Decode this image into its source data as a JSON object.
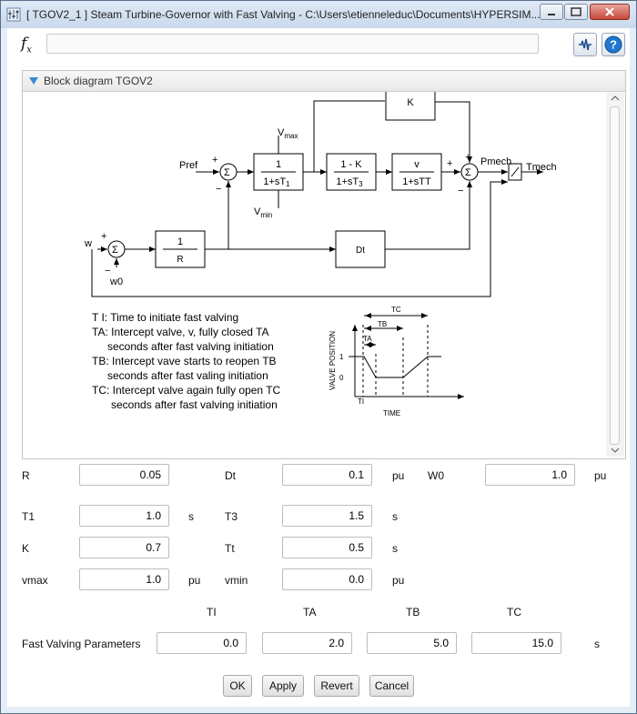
{
  "window": {
    "title": "[ TGOV2_1 ]  Steam Turbine-Governor with Fast Valving - C:\\Users\\etienneleduc\\Documents\\HYPERSIM..."
  },
  "toolbar": {
    "fx_label": "fx",
    "formula_value": ""
  },
  "panel": {
    "title": "Block diagram TGOV2",
    "diagram": {
      "pref": "Pref",
      "plus": "+",
      "minus": "−",
      "sigma": "Σ",
      "vmax": "V",
      "vmax_sub": "max",
      "vmin": "V",
      "vmin_sub": "min",
      "block_t1_num": "1",
      "block_t1_den": "1+sT",
      "block_t1_sub": "1",
      "block_t3_num": "1 - K",
      "block_t3_den": "1+sT",
      "block_t3_sub": "3",
      "block_tt_num": "v",
      "block_tt_den": "1+sTT",
      "block_k": "K",
      "block_r_num": "1",
      "block_r_den": "R",
      "block_dt": "Dt",
      "pmech": "Pmech",
      "tmech": "Tmech",
      "w": "w",
      "w0": "w0",
      "notes": [
        "T I: Time to initiate fast valving",
        "TA: Intercept valve, v, fully closed TA",
        "seconds after fast valving initiation",
        "TB: Intercept vave starts to reopen TB",
        "seconds after fast valing initiation",
        "TC: Intercept valve again fully open TC",
        "seconds after fast valving initiation"
      ],
      "graph": {
        "tc": "TC",
        "tb": "TB",
        "ta": "TA",
        "ti": "TI",
        "y1": "1",
        "y0": "0",
        "ylabel": "VALVE POSITION",
        "xlabel": "TIME"
      }
    }
  },
  "params": {
    "r_label": "R",
    "r_value": "0.05",
    "dt_label": "Dt",
    "dt_value": "0.1",
    "dt_unit": "pu",
    "w0_label": "W0",
    "w0_value": "1.0",
    "w0_unit": "pu",
    "t1_label": "T1",
    "t1_value": "1.0",
    "t1_unit": "s",
    "t3_label": "T3",
    "t3_value": "1.5",
    "t3_unit": "s",
    "k_label": "K",
    "k_value": "0.7",
    "tt_label": "Tt",
    "tt_value": "0.5",
    "tt_unit": "s",
    "vmax_label": "vmax",
    "vmax_value": "1.0",
    "vmax_unit": "pu",
    "vmin_label": "vmin",
    "vmin_value": "0.0",
    "vmin_unit": "pu",
    "fv_header_ti": "TI",
    "fv_header_ta": "TA",
    "fv_header_tb": "TB",
    "fv_header_tc": "TC",
    "fv_label": "Fast Valving Parameters",
    "fv_ti": "0.0",
    "fv_ta": "2.0",
    "fv_tb": "5.0",
    "fv_tc": "15.0",
    "fv_unit": "s"
  },
  "buttons": {
    "ok": "OK",
    "apply": "Apply",
    "revert": "Revert",
    "cancel": "Cancel"
  },
  "colors": {
    "accent": "#3a8bd6",
    "help": "#1f78d1"
  }
}
